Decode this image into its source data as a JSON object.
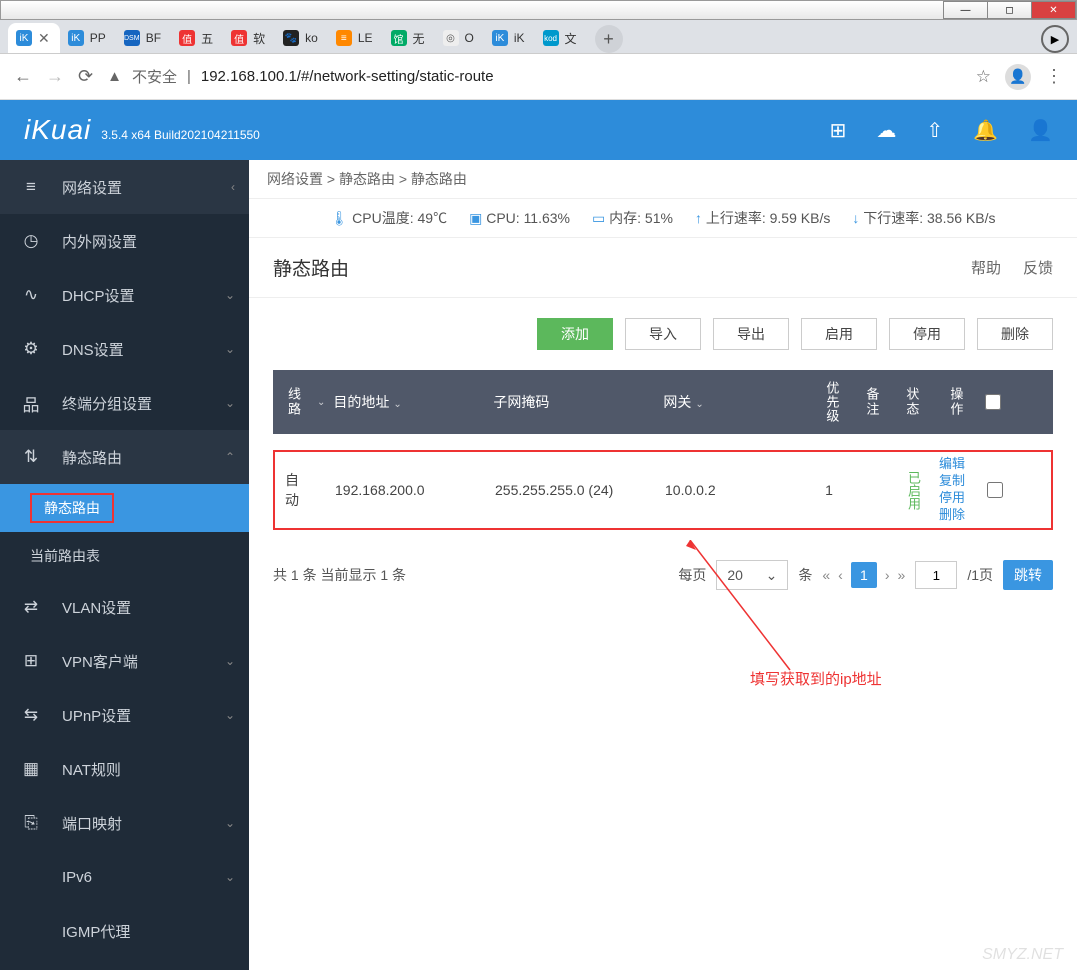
{
  "browser": {
    "tabs": [
      {
        "fav_bg": "#2d8cda",
        "fav_txt": "iK",
        "label": "",
        "active": true,
        "close": true
      },
      {
        "fav_bg": "#2d8cda",
        "fav_txt": "iK",
        "label": "PP"
      },
      {
        "fav_bg": "#1565c0",
        "fav_txt": "DSM",
        "label": "BF"
      },
      {
        "fav_bg": "#e33",
        "fav_txt": "值",
        "label": "五"
      },
      {
        "fav_bg": "#e33",
        "fav_txt": "值",
        "label": "软"
      },
      {
        "fav_bg": "#222",
        "fav_txt": "🐾",
        "label": "ko"
      },
      {
        "fav_bg": "#f80",
        "fav_txt": "≡",
        "label": "LE"
      },
      {
        "fav_bg": "#0a6",
        "fav_txt": "馆",
        "label": "无"
      },
      {
        "fav_bg": "#eee",
        "fav_txt": "◎",
        "label": "O"
      },
      {
        "fav_bg": "#2d8cda",
        "fav_txt": "iK",
        "label": "iK"
      },
      {
        "fav_bg": "#09c",
        "fav_txt": "kod",
        "label": "文"
      }
    ],
    "insecure": "不安全",
    "url": "192.168.100.1/#/network-setting/static-route"
  },
  "header": {
    "logo": "iKuai",
    "version": "3.5.4 x64 Build202104211550"
  },
  "sidebar": {
    "section": "网络设置",
    "items": [
      {
        "icon": "◷",
        "label": "内外网设置",
        "chev": ""
      },
      {
        "icon": "∿",
        "label": "DHCP设置",
        "chev": "⌄"
      },
      {
        "icon": "⚙",
        "label": "DNS设置",
        "chev": "⌄"
      },
      {
        "icon": "品",
        "label": "终端分组设置",
        "chev": "⌄"
      },
      {
        "icon": "⇅",
        "label": "静态路由",
        "chev": "⌃",
        "expanded": true
      },
      {
        "icon": "≋",
        "label": "VLAN设置",
        "chev": ""
      },
      {
        "icon": "⊞",
        "label": "VPN客户端",
        "chev": "⌄"
      },
      {
        "icon": "⇆",
        "label": "UPnP设置",
        "chev": "⌄"
      },
      {
        "icon": "▦",
        "label": "NAT规则",
        "chev": ""
      },
      {
        "icon": "⎘",
        "label": "端口映射",
        "chev": "⌄"
      },
      {
        "icon": "",
        "label": "IPv6",
        "chev": "⌄"
      },
      {
        "icon": "",
        "label": "IGMP代理",
        "chev": ""
      }
    ],
    "subs": [
      "静态路由",
      "当前路由表"
    ]
  },
  "breadcrumb": "网络设置 > 静态路由 > 静态路由",
  "stats": {
    "cpu_temp_label": "CPU温度:",
    "cpu_temp": "49℃",
    "cpu_label": "CPU:",
    "cpu": "11.63%",
    "mem_label": "内存:",
    "mem": "51%",
    "up_label": "上行速率:",
    "up": "9.59 KB/s",
    "down_label": "下行速率:",
    "down": "38.56 KB/s"
  },
  "page_title": "静态路由",
  "help": "帮助",
  "feedback": "反馈",
  "actions": {
    "add": "添加",
    "import": "导入",
    "export": "导出",
    "enable": "启用",
    "disable": "停用",
    "delete": "删除"
  },
  "table": {
    "head": {
      "line": "线路",
      "dest": "目的地址",
      "mask": "子网掩码",
      "gw": "网关",
      "prio": "优先级",
      "note": "备注",
      "stat": "状态",
      "op": "操作"
    },
    "row": {
      "line": "自动",
      "dest": "192.168.200.0",
      "mask": "255.255.255.0 (24)",
      "gw": "10.0.0.2",
      "prio": "1",
      "note": "",
      "stat": "已启用"
    },
    "ops": {
      "edit": "编辑",
      "copy": "复制",
      "disable": "停用",
      "delete": "删除"
    }
  },
  "pager": {
    "summary": "共 1 条 当前显示 1 条",
    "per_page": "每页",
    "per_value": "20",
    "unit": "条",
    "current": "1",
    "input": "1",
    "total": "/1页",
    "go": "跳转"
  },
  "annotation": "填写获取到的ip地址",
  "watermark": "SMYZ.NET"
}
